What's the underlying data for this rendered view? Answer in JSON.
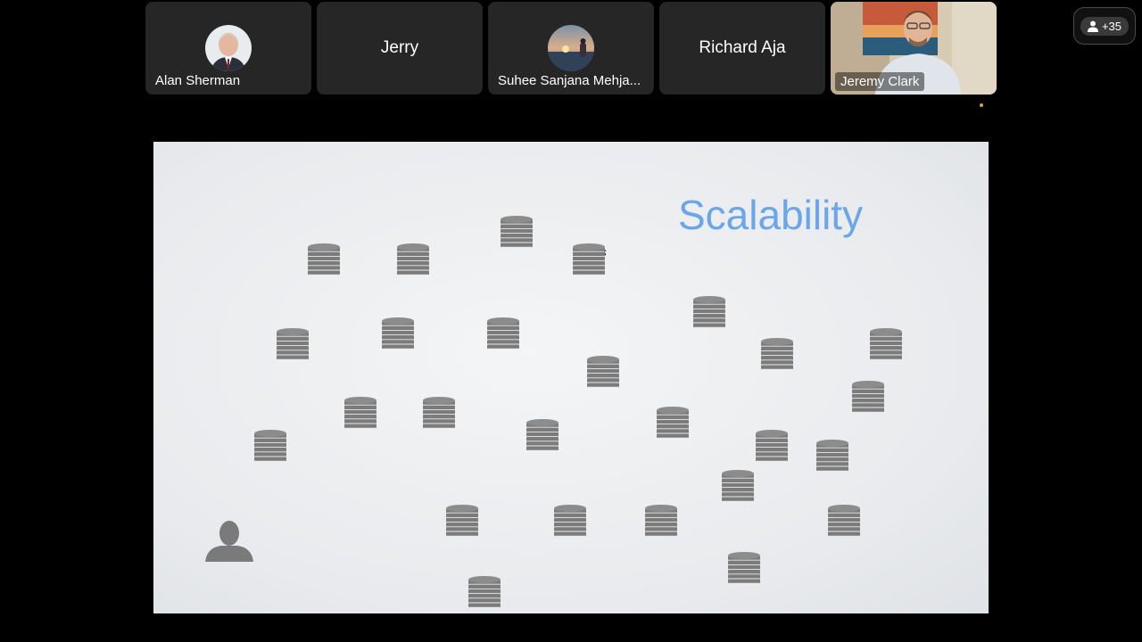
{
  "participants": [
    {
      "name": "Alan Sherman",
      "type": "avatar"
    },
    {
      "name": "Jerry",
      "type": "text"
    },
    {
      "name": "Suhee Sanjana Mehja...",
      "type": "avatar"
    },
    {
      "name": "Richard Aja",
      "type": "text"
    },
    {
      "name": "Jeremy Clark",
      "type": "video"
    }
  ],
  "more_participants": {
    "label": "+35",
    "icon": "person-icon"
  },
  "slide": {
    "title": "Scalability",
    "title_color": "#6aa6e8",
    "icons": [
      "coin-stack-icon",
      "person-silhouette-icon"
    ]
  }
}
